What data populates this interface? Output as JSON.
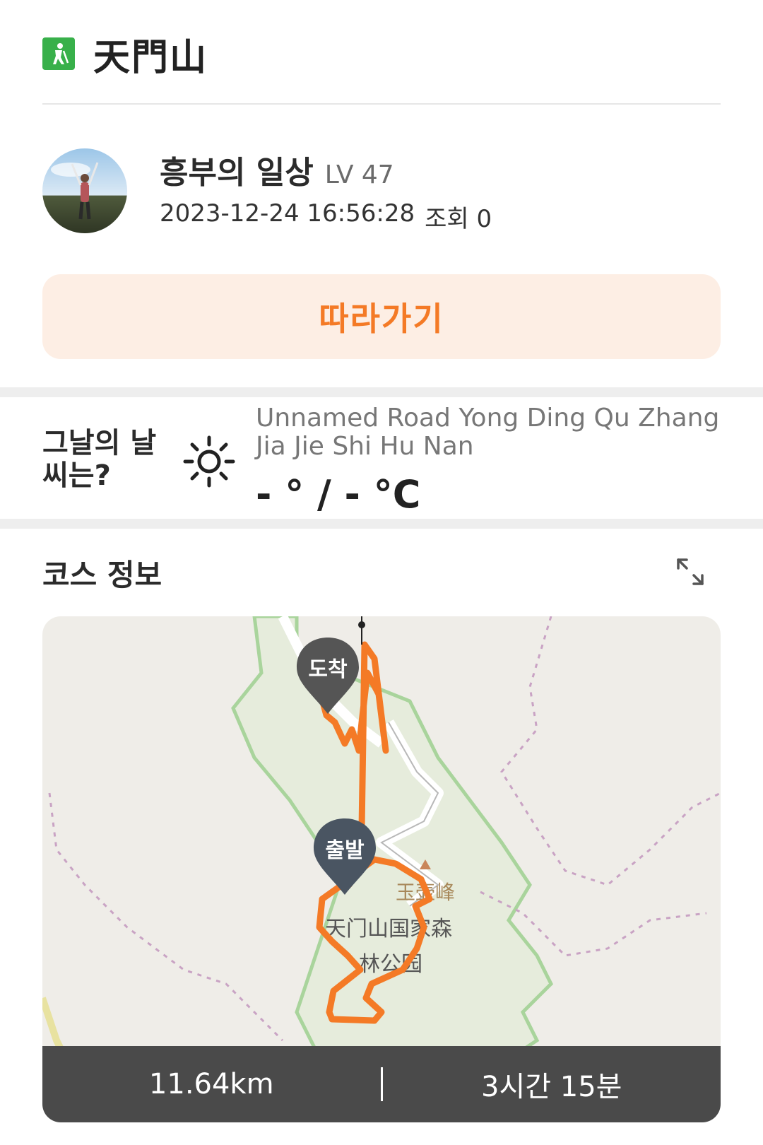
{
  "header": {
    "title": "天門山",
    "icon": "hiking-icon",
    "icon_color": "#38b04a"
  },
  "post": {
    "author": "흥부의 일상",
    "level": "LV 47",
    "datetime": "2023-12-24 16:56:28",
    "views": "조회 0"
  },
  "follow_button": {
    "label": "따라가기",
    "text_color": "#f47a26",
    "bg_color": "#fdeee4"
  },
  "weather": {
    "question": "그날의 날씨는?",
    "icon": "sun-icon",
    "location": "Unnamed Road Yong Ding Qu Zhang Jia Jie Shi Hu Nan",
    "temperature": "- ° / - °C"
  },
  "course": {
    "title": "코스 정보",
    "expand_icon": "expand-icon",
    "map": {
      "arrive_label": "도착",
      "start_label": "출발",
      "place_labels": [
        "玉壶峰",
        "天门山国家森",
        "林公园"
      ],
      "route_color": "#f47a26"
    },
    "distance": "11.64km",
    "duration": "3시간 15분"
  }
}
